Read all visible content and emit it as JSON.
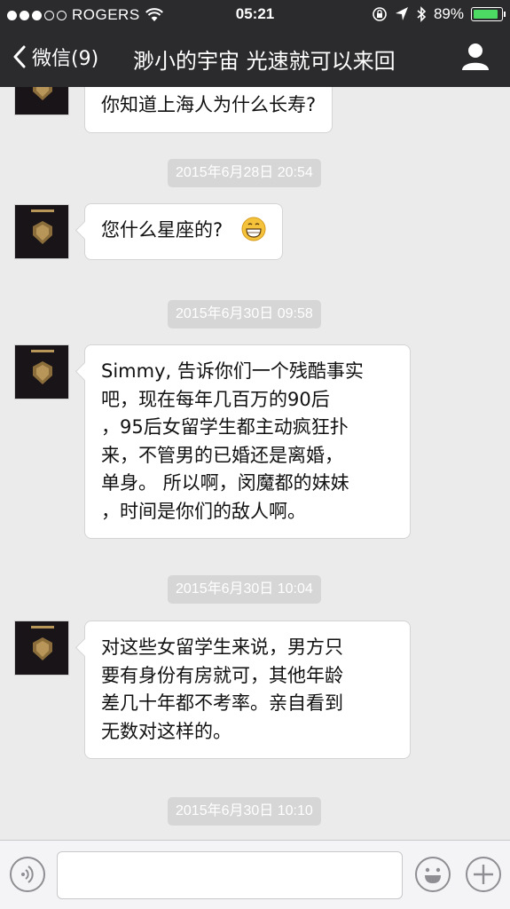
{
  "status": {
    "carrier": "ROGERS",
    "time": "05:21",
    "battery_pct": "89%",
    "battery_level": 0.89
  },
  "nav": {
    "back_label": "微信(9)",
    "title": "渺小的宇宙 光速就可以来回"
  },
  "messages": [
    {
      "text": "你知道上海人为什么长寿?"
    },
    {
      "timestamp": "2015年6月28日 20:54"
    },
    {
      "text": "您什么星座的?",
      "emoji": "grinning-face-icon"
    },
    {
      "timestamp": "2015年6月30日 09:58"
    },
    {
      "lines": [
        "Simmy, 告诉你们一个残酷事实",
        "吧，现在每年几百万的90后",
        "，95后女留学生都主动疯狂扑",
        "来，不管男的已婚还是离婚，",
        "单身。 所以啊，闵魔都的妹妹",
        "，时间是你们的敌人啊。"
      ]
    },
    {
      "timestamp": "2015年6月30日 10:04"
    },
    {
      "lines": [
        "对这些女留学生来说，男方只",
        "要有身份有房就可，其他年龄",
        "差几十年都不考率。亲自看到",
        "无数对这样的。"
      ]
    },
    {
      "timestamp": "2015年6月30日 10:10"
    }
  ],
  "input": {
    "value": "",
    "icons": [
      "voice-icon",
      "emoji-icon",
      "plus-icon"
    ]
  },
  "colors": {
    "nav_bg": "#2b2b2d",
    "chat_bg": "#ebebeb",
    "timestamp_bg": "#d6d6d6",
    "battery_green": "#4cd964"
  }
}
